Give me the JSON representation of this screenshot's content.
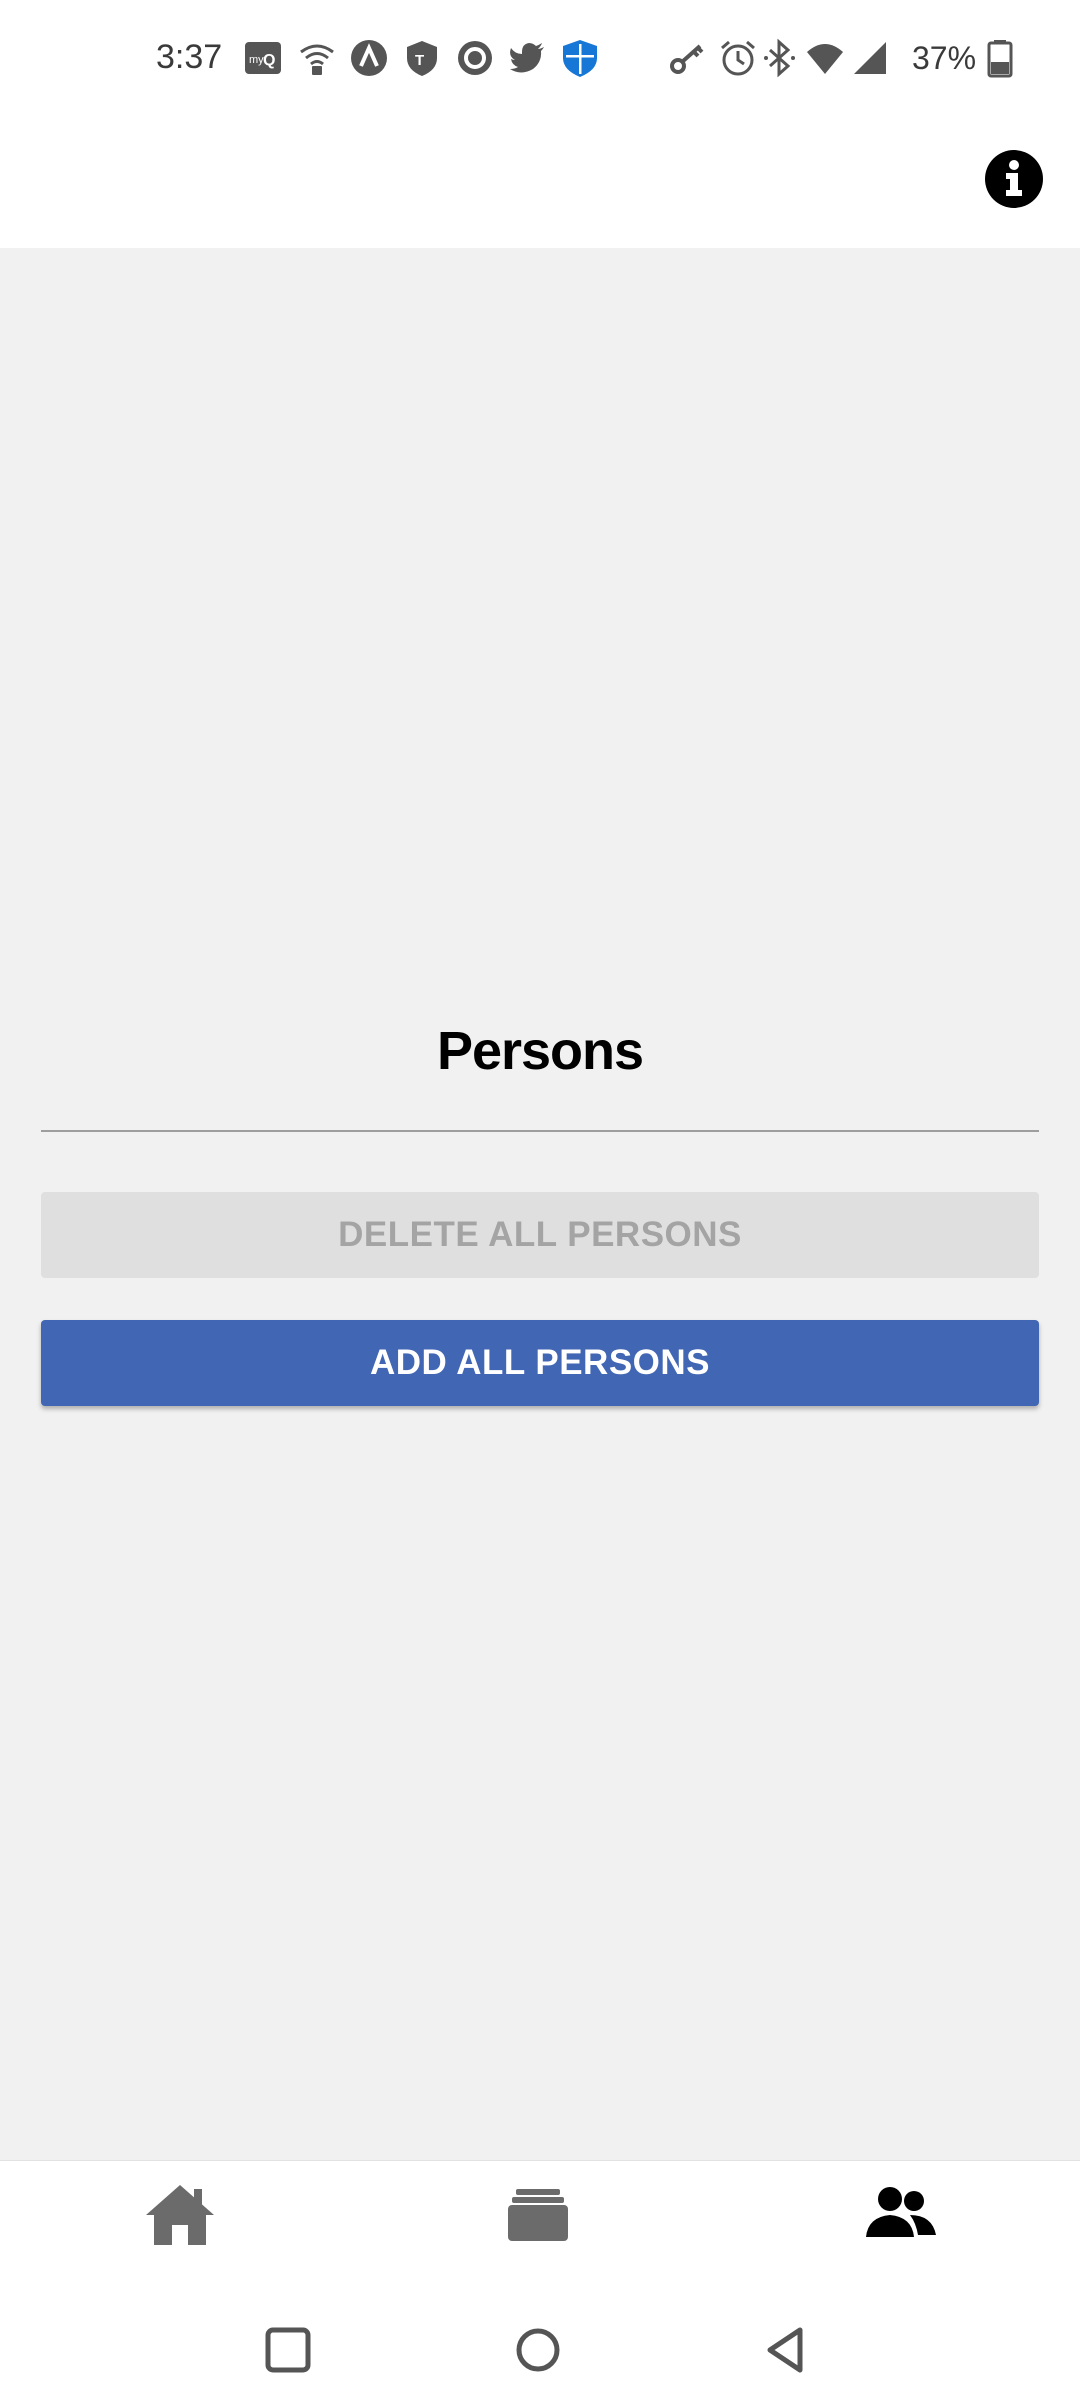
{
  "status_bar": {
    "time": "3:37",
    "battery": "37%",
    "icons": [
      "myq-icon",
      "wifi-calling-icon",
      "arrow-up-icon",
      "tmobile-icon",
      "circle-app-icon",
      "twitter-icon",
      "shield-icon",
      "key-icon",
      "alarm-icon",
      "bluetooth-icon",
      "wifi-icon",
      "signal-icon",
      "battery-icon"
    ]
  },
  "header": {
    "info_icon": "info-icon"
  },
  "main": {
    "title": "Persons",
    "delete_button": "DELETE ALL PERSONS",
    "add_button": "ADD ALL PERSONS"
  },
  "tabs": [
    {
      "icon": "home-icon",
      "active": false
    },
    {
      "icon": "stack-icon",
      "active": false
    },
    {
      "icon": "people-icon",
      "active": true
    }
  ],
  "colors": {
    "primary": "#4166b3",
    "disabled_bg": "#dfdfdf",
    "disabled_text": "#a4a4a4",
    "background": "#f1f1f1"
  }
}
